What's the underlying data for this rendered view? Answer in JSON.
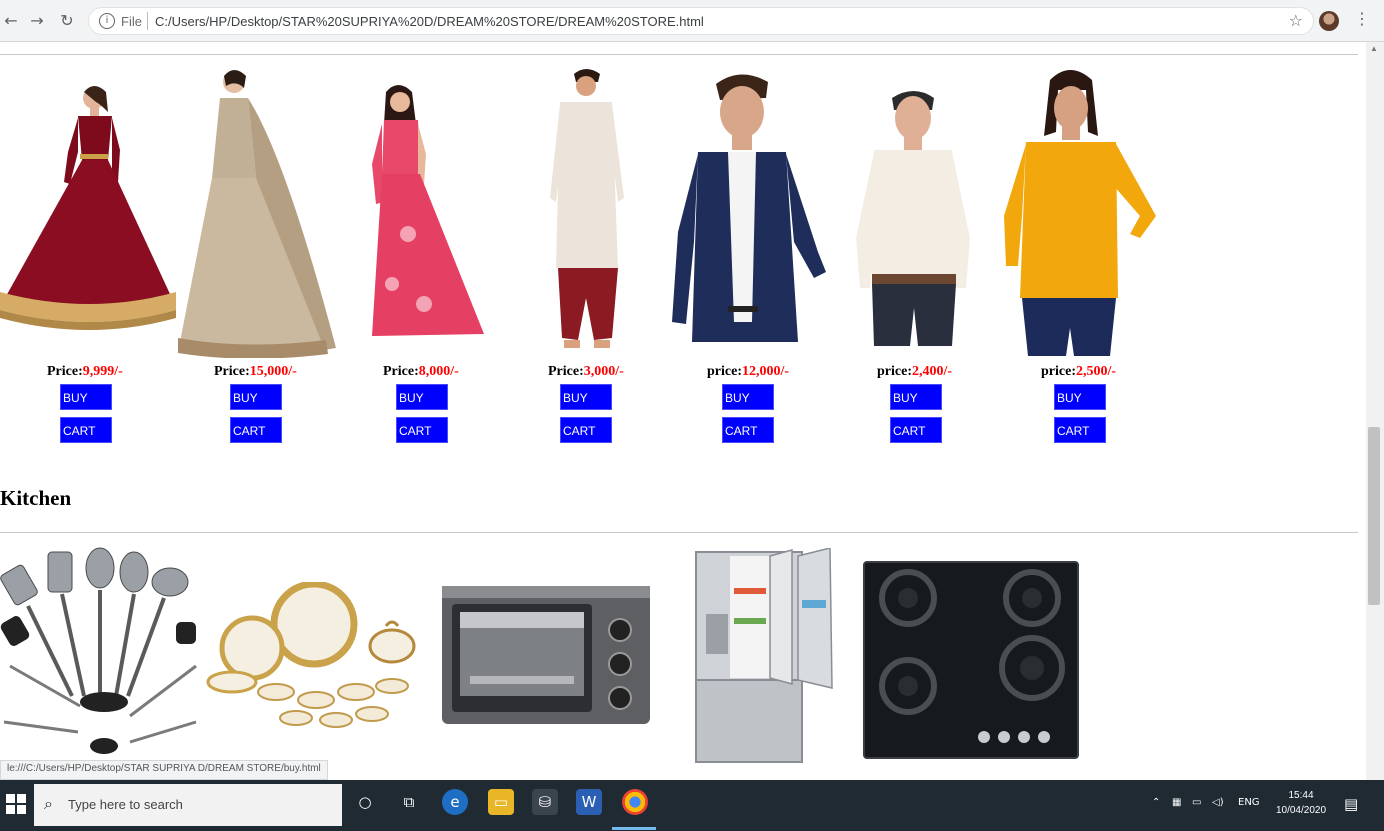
{
  "browser": {
    "scheme_label": "File",
    "url": "C:/Users/HP/Desktop/STAR%20SUPRIYA%20D/DREAM%20STORE/DREAM%20STORE.html",
    "status_url": "le:///C:/Users/HP/Desktop/STAR SUPRIYA D/DREAM STORE/buy.html"
  },
  "clothing": [
    {
      "name": "maroon-lehenga-dress",
      "price_label": "Price:",
      "price": "9,999/-",
      "buy": "BUY",
      "cart": "CART"
    },
    {
      "name": "beige-gown-with-dupatta",
      "price_label": "Price:",
      "price": "15,000/-",
      "buy": "BUY",
      "cart": "CART"
    },
    {
      "name": "pink-saree",
      "price_label": "Price:",
      "price": "8,000/-",
      "buy": "BUY",
      "cart": "CART"
    },
    {
      "name": "white-kurta-dhoti",
      "price_label": "Price:",
      "price": "3,000/-",
      "buy": "BUY",
      "cart": "CART"
    },
    {
      "name": "navy-blazer",
      "price_label": "price:",
      "price": "12,000/-",
      "buy": "BUY",
      "cart": "CART"
    },
    {
      "name": "checked-shirt",
      "price_label": "price:",
      "price": "2,400/-",
      "buy": "BUY",
      "cart": "CART"
    },
    {
      "name": "mustard-top",
      "price_label": "price:",
      "price": "2,500/-",
      "buy": "BUY",
      "cart": "CART"
    }
  ],
  "kitchen": {
    "title": "Kitchen",
    "items": [
      "utensil-set",
      "dinner-set",
      "oven-toaster-grill",
      "refrigerator",
      "gas-hob"
    ]
  },
  "taskbar": {
    "search_placeholder": "Type here to search",
    "language": "ENG",
    "time": "15:44",
    "date": "10/04/2020"
  },
  "colors": {
    "button": "#0000ff",
    "price": "#ff0000",
    "taskbar": "#1f2a33"
  }
}
